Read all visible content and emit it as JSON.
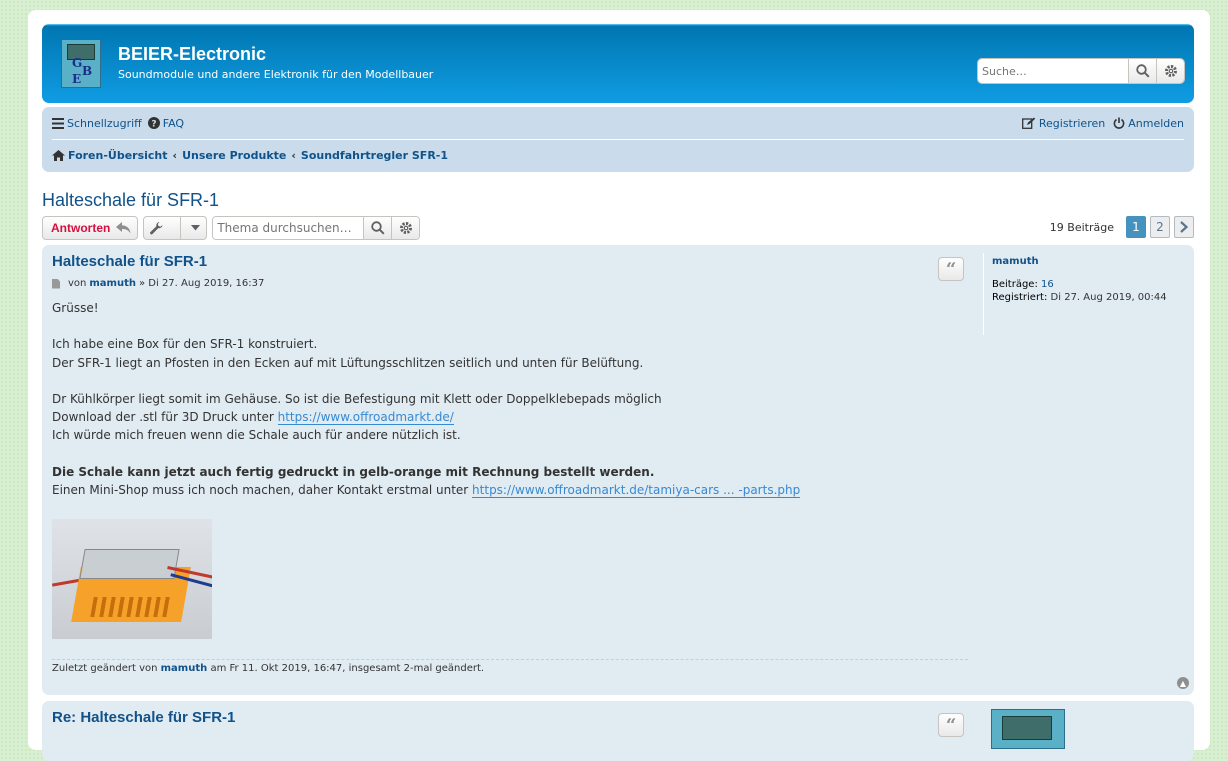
{
  "header": {
    "site_title": "BEIER-Electronic",
    "site_description": "Soundmodule und andere Elektronik für den Modellbauer",
    "logo_letters": [
      "G",
      "B",
      "E"
    ],
    "search_placeholder": "Suche…"
  },
  "navbar": {
    "quick_links": "Schnellzugriff",
    "faq": "FAQ",
    "register": "Registrieren",
    "login": "Anmelden",
    "breadcrumbs": [
      "Foren-Übersicht",
      "Unsere Produkte",
      "Soundfahrtregler SFR-1"
    ]
  },
  "topic": {
    "title": "Halteschale für SFR-1",
    "reply_label": "Antworten",
    "search_placeholder": "Thema durchsuchen…",
    "post_count": "19 Beiträge",
    "pages": [
      "1",
      "2"
    ],
    "current_page": "1"
  },
  "posts": [
    {
      "title": "Halteschale für SFR-1",
      "by": "von",
      "author": "mamuth",
      "date": "» Di 27. Aug 2019, 16:37",
      "lines": [
        "Grüsse!",
        "Ich habe eine Box für den SFR-1 konstruiert.",
        "Der SFR-1 liegt an Pfosten in den Ecken auf mit Lüftungsschlitzen seitlich und unten für Belüftung.",
        "Dr Kühlkörper liegt somit im Gehäuse. So ist die Befestigung mit Klett oder Doppelklebepads möglich",
        "Download der .stl für 3D Druck unter ",
        "https://www.offroadmarkt.de/",
        "Ich würde mich freuen wenn die Schale auch für andere nützlich ist.",
        "Die Schale kann jetzt auch fertig gedruckt in gelb-orange mit Rechnung bestellt werden.",
        "Einen Mini-Shop muss ich noch machen, daher Kontakt erstmal unter ",
        "https://www.offroadmarkt.de/tamiya-cars ... -parts.php"
      ],
      "edited_prefix": "Zuletzt geändert von",
      "edited_user": "mamuth",
      "edited_suffix": "am Fr 11. Okt 2019, 16:47, insgesamt 2-mal geändert.",
      "profile": {
        "username": "mamuth",
        "posts_label": "Beiträge:",
        "posts_value": "16",
        "registered_label": "Registriert:",
        "registered_value": "Di 27. Aug 2019, 00:44"
      }
    },
    {
      "title": "Re: Halteschale für SFR-1"
    }
  ],
  "colors": {
    "header_gradient_top": "#0076b1",
    "header_gradient_bottom": "#12a3eb",
    "link": "#105289",
    "reply": "#d31141",
    "post_bg": "#e1ebf2",
    "nav_bg": "#cadceb",
    "active_page": "#4692bf"
  }
}
